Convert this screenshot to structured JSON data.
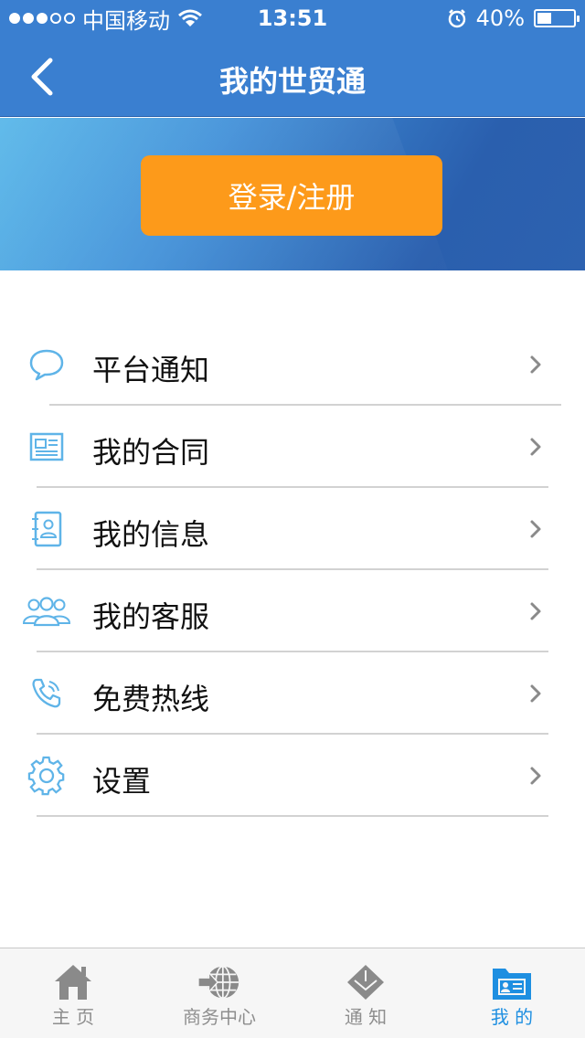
{
  "status_bar": {
    "carrier": "中国移动",
    "time": "13:51",
    "battery": "40%",
    "battery_level": 0.4
  },
  "nav": {
    "title": "我的世贸通",
    "back_icon": "back-chevron-icon"
  },
  "banner": {
    "login_label": "登录/注册"
  },
  "menu": {
    "items": [
      {
        "label": "平台通知",
        "icon": "chat-bubble-icon"
      },
      {
        "label": "我的合同",
        "icon": "document-icon"
      },
      {
        "label": "我的信息",
        "icon": "contact-book-icon"
      },
      {
        "label": "我的客服",
        "icon": "users-group-icon"
      },
      {
        "label": "免费热线",
        "icon": "phone-icon"
      },
      {
        "label": "设置",
        "icon": "gear-icon"
      }
    ]
  },
  "tabbar": {
    "items": [
      {
        "label": "主 页",
        "icon": "home-icon"
      },
      {
        "label": "商务中心",
        "icon": "globe-arrow-icon"
      },
      {
        "label": "通 知",
        "icon": "envelope-icon"
      },
      {
        "label": "我 的",
        "icon": "folder-card-icon"
      }
    ],
    "active_index": 3
  },
  "colors": {
    "header_blue": "#3a7fd0",
    "login_orange": "#fd9a1a",
    "icon_blue": "#5fb4e8",
    "active_tab": "#1e8fe1",
    "inactive_tab": "#8e8e8e"
  }
}
